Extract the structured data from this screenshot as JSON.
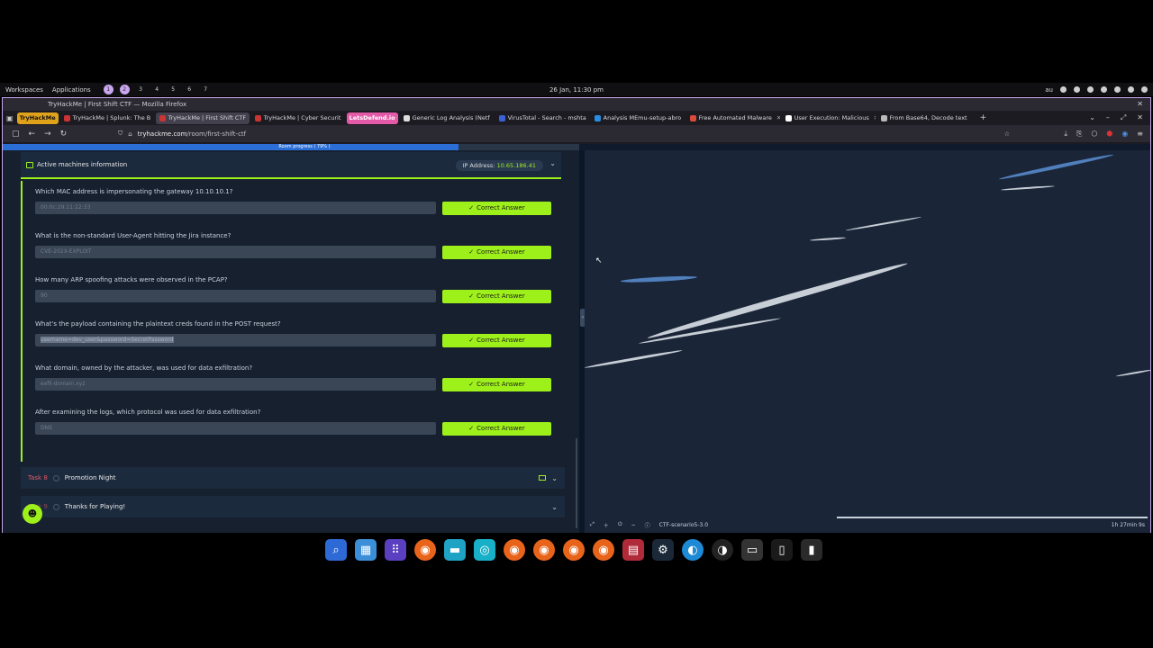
{
  "desktop": {
    "workspaces_label": "Workspaces",
    "applications_label": "Applications",
    "workspace_numbers": [
      "1",
      "2",
      "3",
      "4",
      "5",
      "6",
      "7"
    ],
    "clock": "26 Jan, 11:30 pm",
    "tray_lang": "au"
  },
  "browser": {
    "window_title": "TryHackMe | First Shift CTF — Mozilla Firefox",
    "tabs": [
      {
        "label": "TryHackMe",
        "kind": "badge-thm"
      },
      {
        "label": "TryHackMe | Splunk: The B",
        "kind": "tab"
      },
      {
        "label": "TryHackMe | First Shift CTF",
        "kind": "active"
      },
      {
        "label": "TryHackMe | Cyber Securit",
        "kind": "tab"
      },
      {
        "label": "LetsDefend.io",
        "kind": "badge-ld"
      },
      {
        "label": "Generic Log Analysis (Netf",
        "kind": "tab"
      },
      {
        "label": "VirusTotal - Search - mshta",
        "kind": "tab"
      },
      {
        "label": "Analysis MEmu-setup-abro",
        "kind": "tab"
      },
      {
        "label": "Free Automated Malware",
        "kind": "tab"
      },
      {
        "label": "User Execution: Malicious",
        "kind": "tab"
      },
      {
        "label": "From Base64, Decode text",
        "kind": "tab"
      }
    ],
    "url_host": "tryhackme.com",
    "url_path": "/room/first-shift-ctf"
  },
  "room": {
    "progress_text": "Room progress ( 79% )",
    "progress_percent": 79,
    "active_machines_label": "Active machines information",
    "ip_label": "IP Address:",
    "ip_value": "10.65.186.41",
    "questions": [
      {
        "q": "Which MAC address is impersonating the gateway 10.10.10.1?",
        "a": "00:0c:29:11:22:33"
      },
      {
        "q": "What is the non-standard User-Agent hitting the Jira instance?",
        "a": "CVE-202X-EXPLOIT"
      },
      {
        "q": "How many ARP spoofing attacks were observed in the PCAP?",
        "a": "90"
      },
      {
        "q": "What's the payload containing the plaintext creds found in the POST request?",
        "a": "username=dev_user&password=SecretPassword"
      },
      {
        "q": "What domain, owned by the attacker, was used for data exfiltration?",
        "a": "exfil-domain.xyz"
      },
      {
        "q": "After examining the logs, which protocol was used for data exfiltration?",
        "a": "DNS"
      }
    ],
    "correct_label": "Correct Answer",
    "tasks": [
      {
        "num": "Task 8",
        "title": "Promotion Night"
      },
      {
        "num": "Task 9",
        "title": "Thanks for Playing!"
      }
    ]
  },
  "vm": {
    "machine_name": "CTF-scenario5-3.0",
    "time_left": "1h 27min 9s"
  }
}
